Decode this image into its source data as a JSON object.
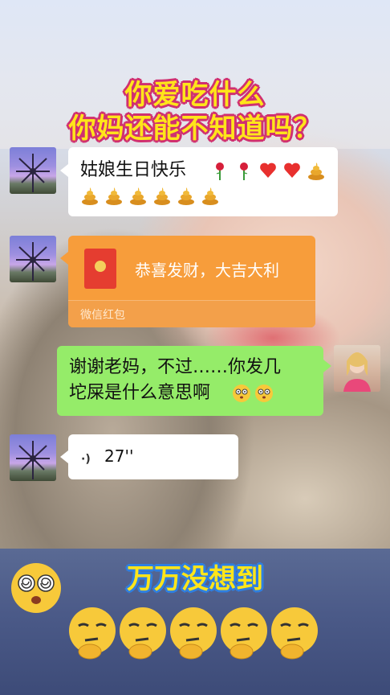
{
  "headline": {
    "line1": "你爱吃什么",
    "line2": "你妈还能不知道吗？"
  },
  "messages": [
    {
      "sender": "mom",
      "type": "text",
      "text": "姑娘生日快乐",
      "emojis": [
        "rose-icon",
        "rose-icon",
        "heart-icon",
        "heart-icon",
        "poop-icon",
        "poop-icon",
        "poop-icon",
        "poop-icon",
        "poop-icon",
        "poop-icon",
        "poop-icon"
      ]
    },
    {
      "sender": "mom",
      "type": "red-packet",
      "title": "恭喜发财，大吉大利",
      "label": "微信红包"
    },
    {
      "sender": "me",
      "type": "text",
      "line1": "谢谢老妈，不过……你发几",
      "line2": "坨屎是什么意思啊",
      "emojis": [
        "dizzy-face-icon",
        "dizzy-face-icon"
      ]
    },
    {
      "sender": "mom",
      "type": "voice",
      "duration": "27''"
    }
  ],
  "banner": {
    "text": "万万没想到"
  },
  "colors": {
    "headline_fill": "#ffe51a",
    "headline_outline": "#d03070",
    "banner_outline": "#2f7fe0",
    "my_bubble": "#95ec69",
    "red_packet": "#f79d3b"
  }
}
